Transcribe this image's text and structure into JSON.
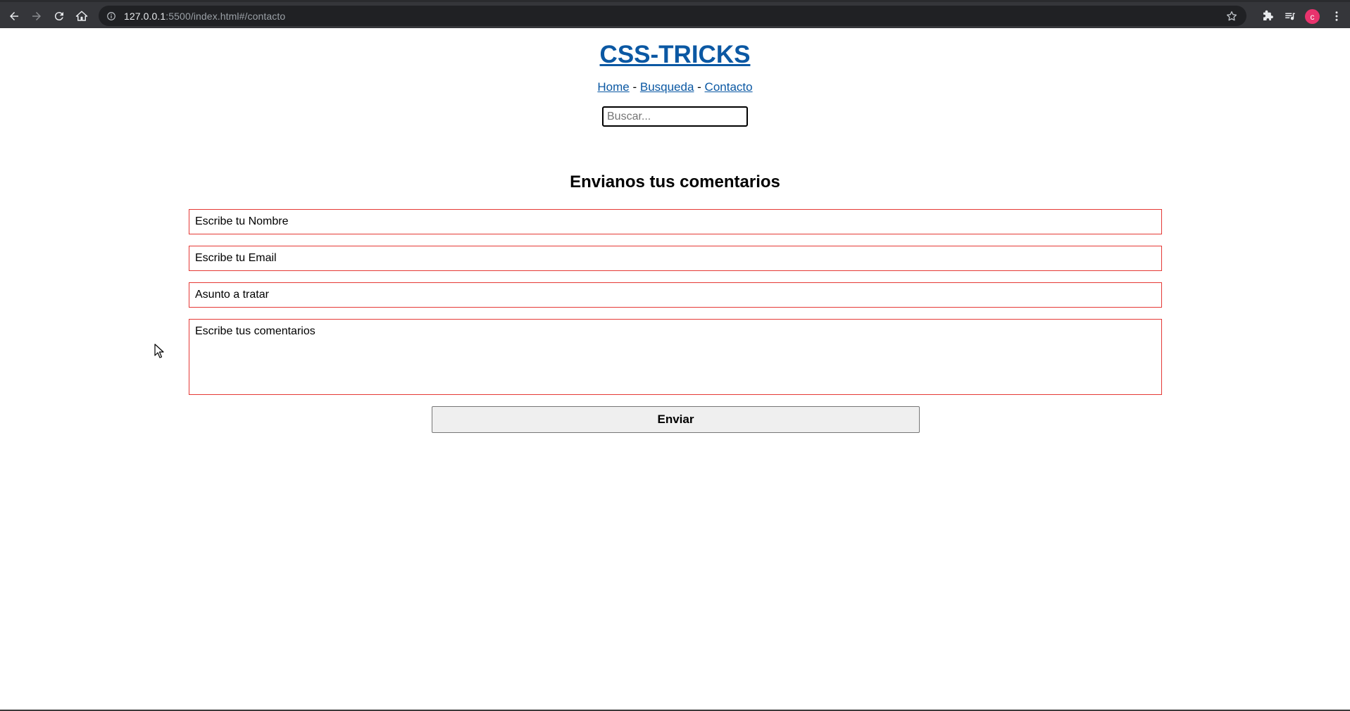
{
  "browser": {
    "url_host": "127.0.0.1",
    "url_rest": ":5500/index.html#/contacto",
    "avatar_letter": "c",
    "icons": [
      "back-arrow-icon",
      "forward-arrow-icon",
      "reload-icon",
      "home-icon",
      "info-icon",
      "star-icon",
      "extensions-icon",
      "media-icon",
      "menu-icon"
    ],
    "avatar_color": "#e8336d"
  },
  "header": {
    "title": "CSS-TRICKS",
    "nav": [
      {
        "label": "Home"
      },
      {
        "label": "Busqueda"
      },
      {
        "label": "Contacto"
      }
    ],
    "separator": " - ",
    "search_placeholder": "Buscar..."
  },
  "form": {
    "title": "Envianos tus comentarios",
    "name_placeholder": "Escribe tu Nombre",
    "email_placeholder": "Escribe tu Email",
    "subject_placeholder": "Asunto a tratar",
    "comments_placeholder": "Escribe tus comentarios",
    "submit_label": "Enviar"
  },
  "colors": {
    "link": "#0b58a3",
    "field_border": "#e53935",
    "chrome_bg": "#35363a"
  }
}
